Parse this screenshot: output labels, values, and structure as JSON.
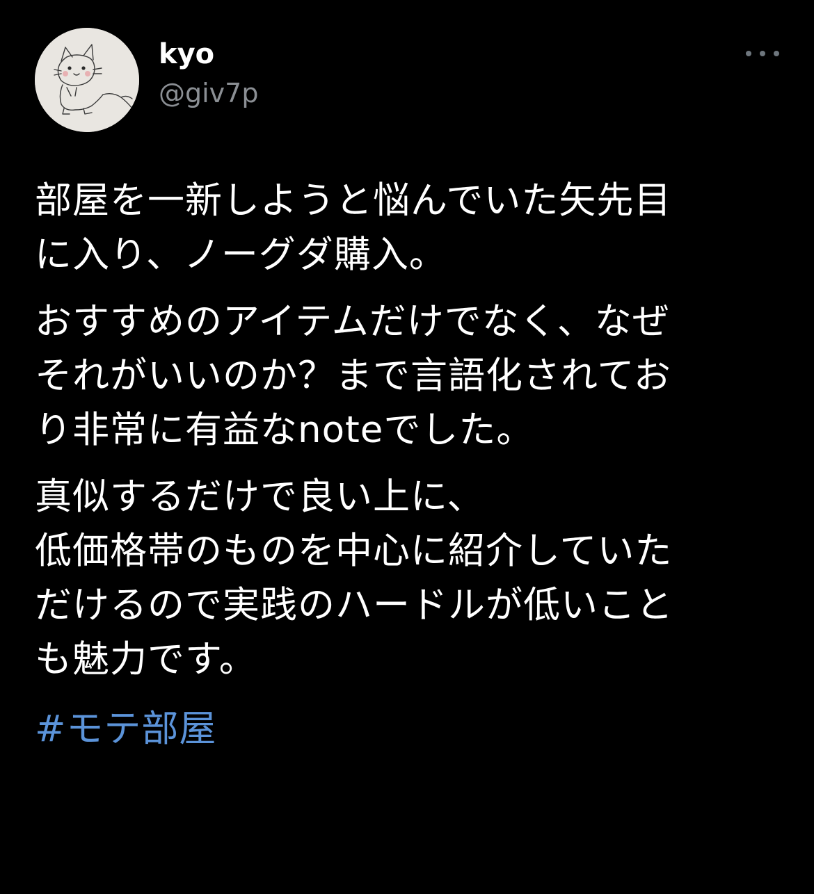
{
  "tweet": {
    "author": {
      "display_name": "kyo",
      "handle": "@giv7p",
      "avatar_icon": "cat-sketch-avatar-icon"
    },
    "more_icon": "more-options-icon",
    "paragraphs": [
      "部屋を一新しようと悩んでいた矢先目\nに入り、ノーグダ購入。",
      "おすすめのアイテムだけでなく、なぜ\nそれがいいのか？まで言語化されてお\nり非常に有益なnoteでした。",
      "真似するだけで良い上に、\n低価格帯のものを中心に紹介していた\nだけるので実践のハードルが低いこと\nも魅力です。"
    ],
    "hashtag": "#モテ部屋"
  },
  "colors": {
    "background": "#000000",
    "text": "#ffffff",
    "handle": "#8b8f94",
    "hashtag": "#5b93d9"
  }
}
